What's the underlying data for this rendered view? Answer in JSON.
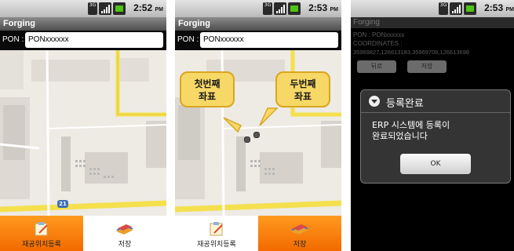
{
  "screens": [
    {
      "status": {
        "net": "3G",
        "time": "2:52",
        "ampm": "PM"
      },
      "app_title": "Forging",
      "pon": {
        "label": "PON :",
        "value": "PONxxxxxx"
      },
      "map": {
        "road_label": "21"
      },
      "bottom": {
        "register_label": "재공위치등록",
        "save_label": "저장",
        "active": "register"
      }
    },
    {
      "status": {
        "net": "3G",
        "time": "2:53",
        "ampm": "PM"
      },
      "app_title": "Forging",
      "pon": {
        "label": "PON :",
        "value": "PONxxxxxx"
      },
      "callouts": {
        "first": [
          "첫번째",
          "좌표"
        ],
        "second": [
          "두번째",
          "좌표"
        ]
      },
      "bottom": {
        "register_label": "재공위치등록",
        "save_label": "저장",
        "active": "save"
      }
    },
    {
      "status": {
        "net": "3G",
        "time": "2:53",
        "ampm": "PM"
      },
      "app_title": "Forging",
      "pon_line": "PON : PONxxxxxx",
      "coordinates_label": "COORDINATES :",
      "coordinates_value": "35969827,126613183,35969706,126613698",
      "back_label": "뒤로",
      "save_label": "저장",
      "dialog": {
        "title": "등록완료",
        "message_line1": "ERP 시스템에 등록이",
        "message_line2": "완료되었습니다",
        "ok_label": "OK"
      }
    }
  ],
  "colors": {
    "accent": "#f57c00",
    "road": "#f4e04d",
    "map_bg": "#eeeae4",
    "block": "#c9c9c9"
  }
}
